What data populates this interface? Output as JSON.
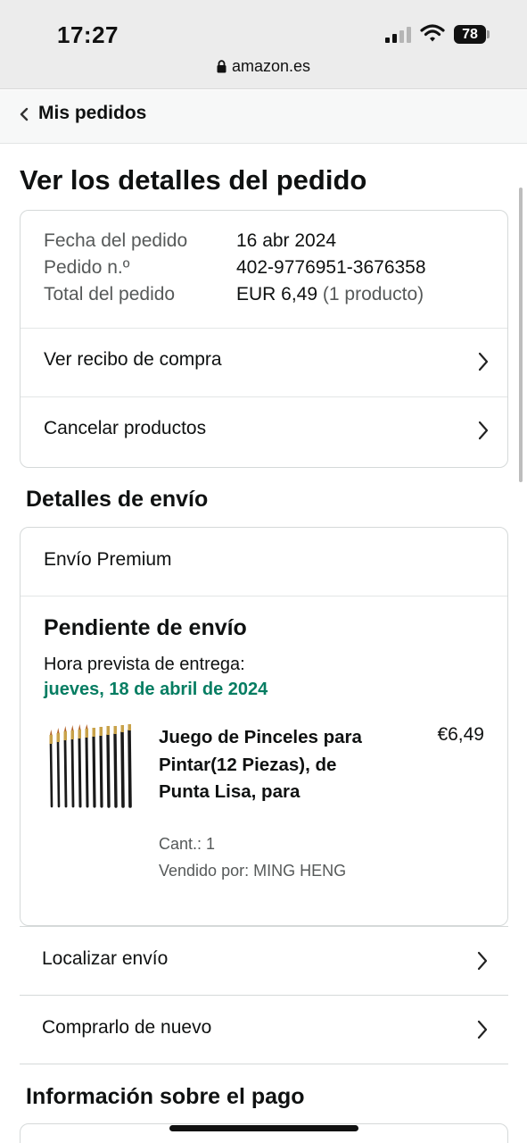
{
  "status_bar": {
    "time": "17:27",
    "battery": "78"
  },
  "browser": {
    "url": "amazon.es"
  },
  "nav": {
    "back_label": "Mis pedidos"
  },
  "page": {
    "title": "Ver los detalles del pedido"
  },
  "order_summary": {
    "date_label": "Fecha del pedido",
    "date_value": "16 abr 2024",
    "number_label": "Pedido n.º",
    "number_value": "402-9776951-3676358",
    "total_label": "Total del pedido",
    "total_value": "EUR 6,49",
    "total_count": "(1 producto)",
    "receipt_link": "Ver recibo de compra",
    "cancel_link": "Cancelar productos"
  },
  "shipping": {
    "section_title": "Detalles de envío",
    "type": "Envío Premium",
    "status": "Pendiente de envío",
    "eta_label": "Hora prevista de entrega:",
    "eta_date": "jueves, 18 de abril de 2024",
    "product": {
      "title": "Juego de Pinceles para Pintar(12 Piezas), de Punta Lisa, para",
      "price": "€6,49",
      "qty": "Cant.: 1",
      "seller": "Vendido por: MING HENG",
      "image_icon": "paintbrush-set-image"
    }
  },
  "actions": {
    "track": "Localizar envío",
    "buy_again": "Comprarlo de nuevo"
  },
  "payment": {
    "section_title": "Información sobre el pago"
  },
  "colors": {
    "eta_green": "#067d62",
    "text": "#0f1111",
    "muted": "#565959",
    "border": "#d5d9d9"
  }
}
